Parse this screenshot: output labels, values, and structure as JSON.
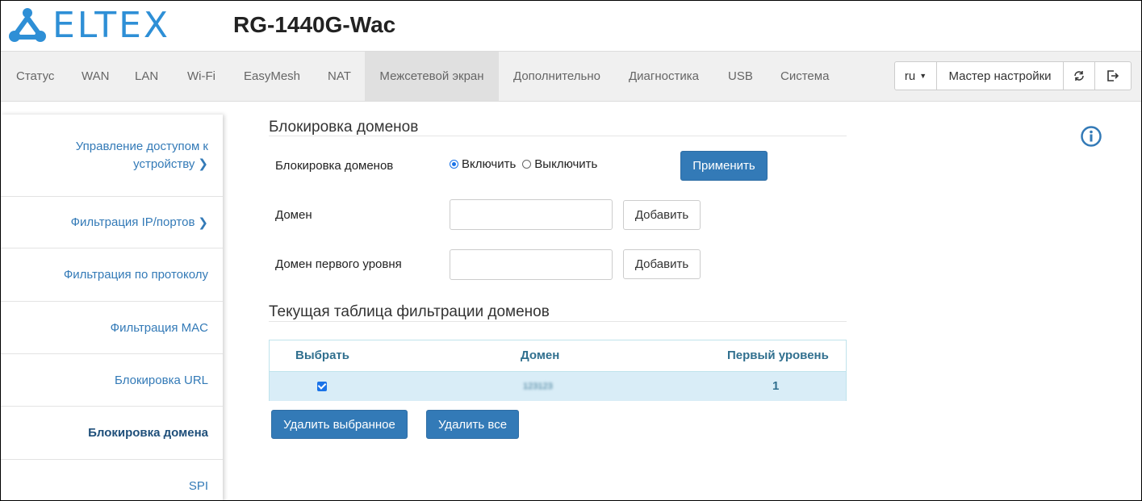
{
  "header": {
    "brand": "ELTEX",
    "device": "RG-1440G-Wac"
  },
  "nav": {
    "items": [
      "Статус",
      "WAN",
      "LAN",
      "Wi-Fi",
      "EasyMesh",
      "NAT",
      "Межсетевой экран",
      "Дополнительно",
      "Диагностика",
      "USB",
      "Система"
    ],
    "active": "Межсетевой экран",
    "language": "ru",
    "wizard": "Мастер настройки",
    "refresh_icon": "refresh-icon",
    "logout_icon": "logout-icon"
  },
  "sidebar": {
    "items": [
      {
        "label": "Управление доступом к устройству",
        "line1": "Управление доступом к",
        "line2": "устройству",
        "chevron": true
      },
      {
        "label": "Фильтрация IP/портов",
        "chevron": true
      },
      {
        "label": "Фильтрация по протоколу",
        "chevron": false
      },
      {
        "label": "Фильтрация MAC",
        "chevron": false
      },
      {
        "label": "Блокировка URL",
        "chevron": false
      },
      {
        "label": "Блокировка домена",
        "chevron": false,
        "active": true
      },
      {
        "label": "SPI",
        "chevron": false
      }
    ]
  },
  "main": {
    "section1_title": "Блокировка доменов",
    "block_label": "Блокировка доменов",
    "radio_enable": "Включить",
    "radio_disable": "Выключить",
    "radio_selected": "Включить",
    "apply_button": "Применить",
    "domain_label": "Домен",
    "domain_value": "",
    "add_button": "Добавить",
    "tld_label": "Домен первого уровня",
    "tld_value": "",
    "add_button_2": "Добавить",
    "section2_title": "Текущая таблица фильтрации доменов",
    "table": {
      "headers": [
        "Выбрать",
        "Домен",
        "Первый уровень"
      ],
      "rows": [
        {
          "selected": true,
          "domain": "123123",
          "first_level": "1"
        }
      ]
    },
    "delete_selected_button": "Удалить выбранное",
    "delete_all_button": "Удалить все",
    "info_icon": "info-icon"
  },
  "colors": {
    "brand": "#2e8fd6",
    "primary": "#337ab7",
    "table_row": "#d9edf7",
    "table_text": "#31708f"
  }
}
